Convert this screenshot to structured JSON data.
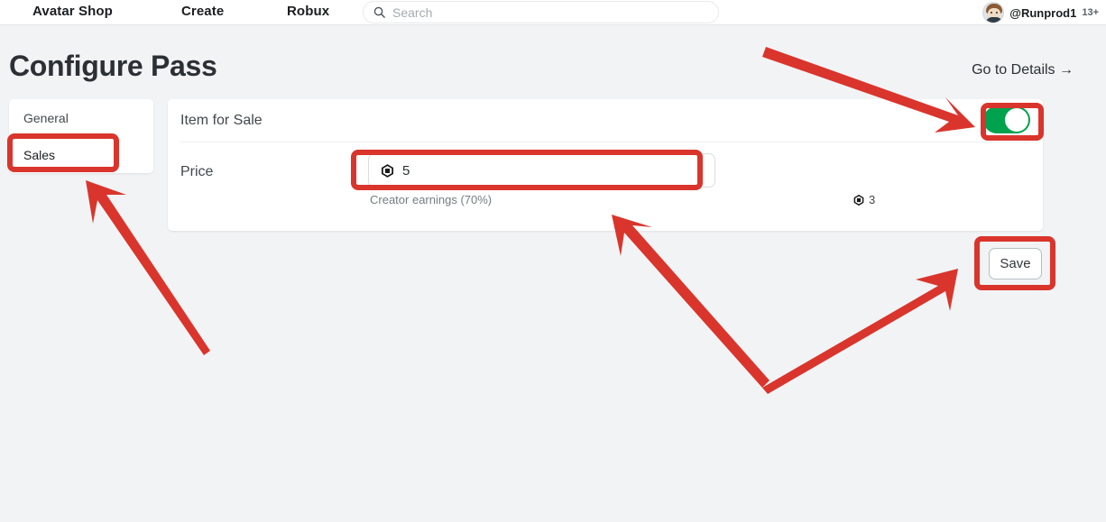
{
  "navbar": {
    "links": [
      {
        "label": "Avatar Shop",
        "name": "nav-link-avatar-shop"
      },
      {
        "label": "Create",
        "name": "nav-link-create"
      },
      {
        "label": "Robux",
        "name": "nav-link-robux"
      }
    ],
    "search": {
      "placeholder": "Search",
      "value": "",
      "icon": "search-icon"
    },
    "user": {
      "username": "@Runprod1",
      "age_badge": "13+",
      "avatar_icon": "avatar"
    }
  },
  "header": {
    "title": "Configure Pass",
    "go_to_details": "Go to Details →"
  },
  "sidebar": {
    "items": [
      {
        "label": "General",
        "active": false
      },
      {
        "label": "Sales",
        "active": true
      }
    ]
  },
  "main": {
    "item_for_sale": {
      "label": "Item for Sale",
      "toggle_state": "on",
      "toggle_color": "#00a24e"
    },
    "price": {
      "label": "Price",
      "value": "5",
      "currency_icon": "robux-icon",
      "earnings_label": "Creator earnings (70%)",
      "earnings_value": "3",
      "earnings_icon": "robux-icon"
    }
  },
  "actions": {
    "save_label": "Save"
  },
  "annotations": {
    "color": "#d9352c",
    "boxes": [
      "sales-tab",
      "item-for-sale-toggle",
      "price-input",
      "save-button"
    ],
    "arrows": [
      "arrow-to-toggle",
      "arrow-to-sales-tab",
      "arrow-to-price-input",
      "arrow-to-save-button"
    ]
  }
}
